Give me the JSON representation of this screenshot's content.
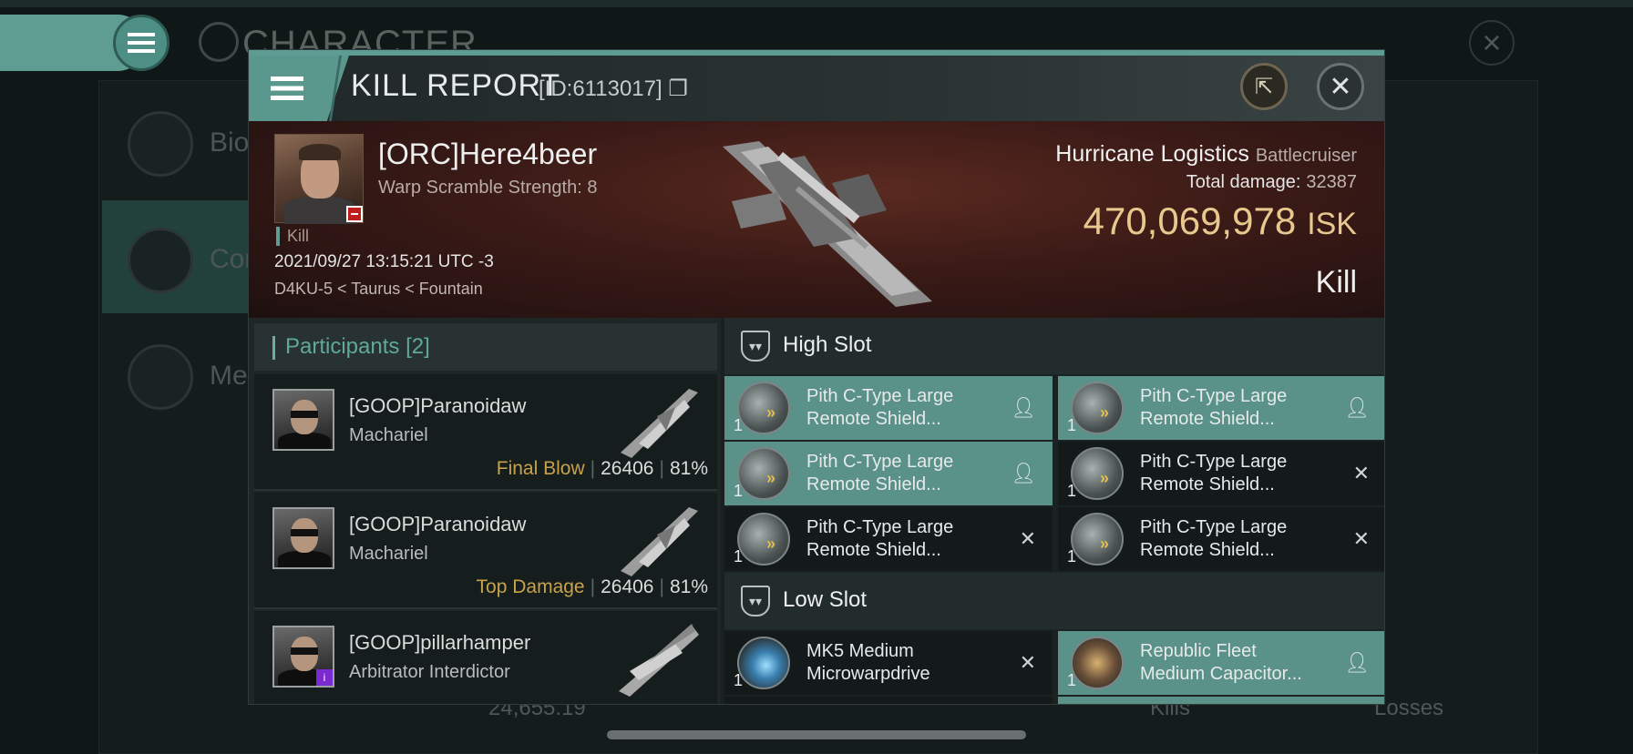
{
  "background": {
    "title": "CHARACTER",
    "side_items": [
      "Bio",
      "Com",
      "Me"
    ],
    "bottom_value": "24,655.19",
    "bottom_kills": "Kills",
    "bottom_losses": "Losses"
  },
  "header": {
    "title": "KILL REPORT",
    "id": "[ID:6113017]"
  },
  "victim": {
    "name": "[ORC]Here4beer",
    "subtitle": "Warp Scramble Strength: 8",
    "tag": "Kill",
    "datetime": "2021/09/27 13:15:21 UTC -3",
    "location": "D4KU-5 < Taurus < Fountain",
    "ship_name": "Hurricane Logistics",
    "ship_class": "Battlecruiser",
    "damage_label": "Total damage:",
    "damage_value": "32387",
    "isk_value": "470,069,978",
    "isk_unit": "ISK",
    "result": "Kill"
  },
  "participants": {
    "label": "Participants",
    "count": "[2]",
    "rows": [
      {
        "name": "[GOOP]Paranoidaw",
        "ship": "Machariel",
        "label": "Final Blow",
        "damage": "26406",
        "percent": "81%"
      },
      {
        "name": "[GOOP]Paranoidaw",
        "ship": "Machariel",
        "label": "Top Damage",
        "damage": "26406",
        "percent": "81%"
      },
      {
        "name": "[GOOP]pillarhamper",
        "ship": "Arbitrator Interdictor",
        "label": "",
        "damage": "",
        "percent": ""
      }
    ]
  },
  "slots": {
    "high_label": "High Slot",
    "low_label": "Low Slot",
    "high_modules": [
      {
        "line1": "Pith C-Type Large",
        "line2": "Remote Shield...",
        "qty": "1",
        "state": "dropped"
      },
      {
        "line1": "Pith C-Type Large",
        "line2": "Remote Shield...",
        "qty": "1",
        "state": "dropped"
      },
      {
        "line1": "Pith C-Type Large",
        "line2": "Remote Shield...",
        "qty": "1",
        "state": "dropped"
      },
      {
        "line1": "Pith C-Type Large",
        "line2": "Remote Shield...",
        "qty": "1",
        "state": "destroyed"
      },
      {
        "line1": "Pith C-Type Large",
        "line2": "Remote Shield...",
        "qty": "1",
        "state": "destroyed"
      },
      {
        "line1": "Pith C-Type Large",
        "line2": "Remote Shield...",
        "qty": "1",
        "state": "destroyed"
      }
    ],
    "low_modules": [
      {
        "line1": "MK5 Medium",
        "line2": "Microwarpdrive",
        "qty": "1",
        "state": "destroyed"
      },
      {
        "line1": "Republic Fleet",
        "line2": "Medium Capacitor...",
        "qty": "1",
        "state": "dropped"
      }
    ]
  },
  "icons": {
    "dropped": "person-icon",
    "destroyed": "x-icon"
  },
  "colors": {
    "accent": "#5f9d93",
    "isk": "#e8c88c",
    "final_blow": "#c8a24a"
  }
}
